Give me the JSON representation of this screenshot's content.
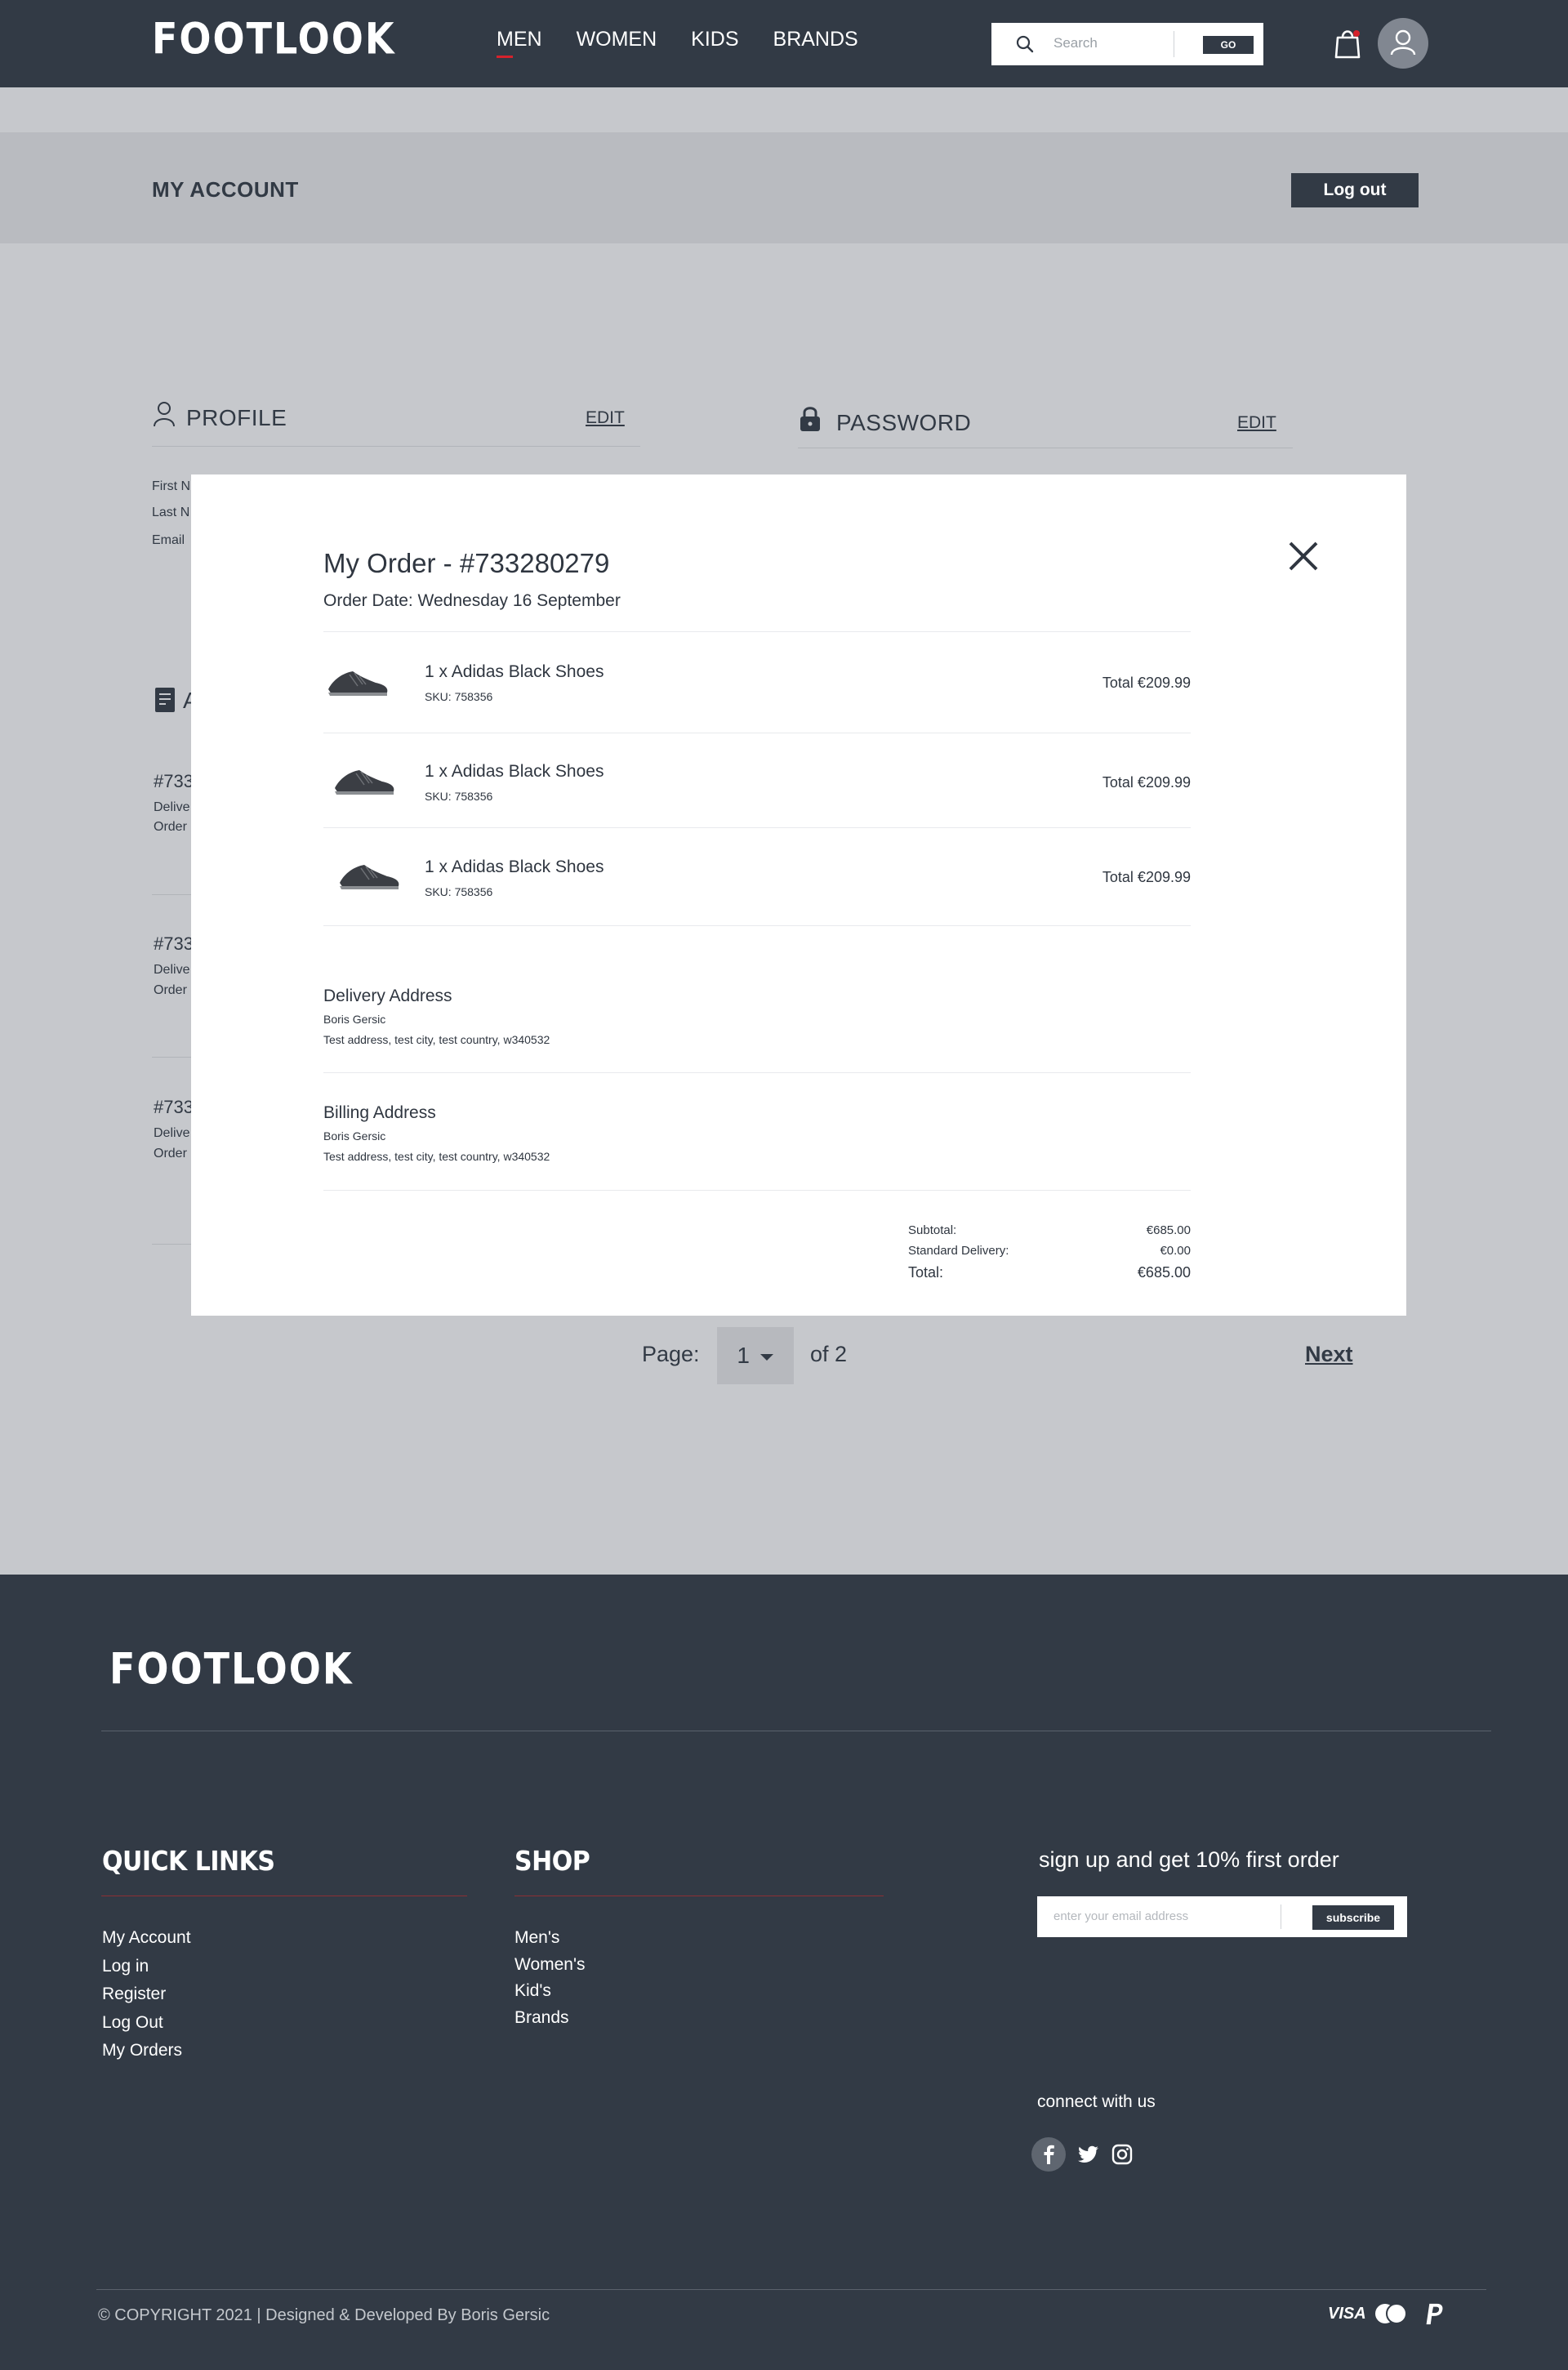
{
  "header": {
    "logo": "FOOTLOOK",
    "nav": [
      "MEN",
      "WOMEN",
      "KIDS",
      "BRANDS"
    ],
    "search_placeholder": "Search",
    "search_button": "GO"
  },
  "account": {
    "title": "MY ACCOUNT",
    "logout": "Log out"
  },
  "background": {
    "profile_heading": "PROFILE",
    "profile_edit": "EDIT",
    "password_heading": "PASSWORD",
    "password_edit": "EDIT",
    "field_first": "First N",
    "field_last": "Last N",
    "field_email": "Email",
    "orders_heading": "A",
    "orders": [
      {
        "number": "#733",
        "delivery": "Delive",
        "order": "Order"
      },
      {
        "number": "#733",
        "delivery": "Delive",
        "order": "Order"
      },
      {
        "number": "#733",
        "delivery": "Delive",
        "order": "Order"
      }
    ]
  },
  "modal": {
    "title": "My Order - #733280279",
    "order_date": "Order Date:  Wednesday 16 September",
    "items": [
      {
        "name": "1 x Adidas Black Shoes",
        "sku": "SKU: 758356",
        "total": "Total €209.99"
      },
      {
        "name": "1 x Adidas Black Shoes",
        "sku": "SKU: 758356",
        "total": "Total €209.99"
      },
      {
        "name": "1 x Adidas Black Shoes",
        "sku": "SKU: 758356",
        "total": "Total €209.99"
      }
    ],
    "delivery": {
      "title": "Delivery Address",
      "name": "Boris Gersic",
      "address": "Test address, test city, test country, w340532"
    },
    "billing": {
      "title": "Billing Address",
      "name": "Boris Gersic",
      "address": "Test address, test city, test country, w340532"
    },
    "summary": {
      "subtotal_label": "Subtotal:",
      "subtotal_value": "€685.00",
      "delivery_label": "Standard Delivery:",
      "delivery_value": "€0.00",
      "total_label": "Total:",
      "total_value": "€685.00"
    }
  },
  "pagination": {
    "label": "Page:",
    "current": "1",
    "of": "of 2",
    "next": "Next"
  },
  "footer": {
    "logo": "FOOTLOOK",
    "quick_links_title": "QUICK LINKS",
    "quick_links": [
      "My Account",
      "Log in",
      "Register",
      "Log Out",
      "My Orders"
    ],
    "shop_title": "SHOP",
    "shop_links": [
      "Men's",
      "Women's",
      "Kid's",
      "Brands"
    ],
    "signup_text": "sign up and get 10% first order",
    "email_placeholder": "enter your email address",
    "subscribe": "subscribe",
    "connect": "connect with us",
    "social": [
      "facebook-icon",
      "twitter-icon",
      "instagram-icon"
    ],
    "copyright": "© COPYRIGHT 2021 | Designed & Developed By Boris Gersic",
    "payments": [
      "VISA",
      "mastercard-icon",
      "paypal-icon"
    ]
  },
  "colors": {
    "primary": "#323a45",
    "accent": "#d6222c",
    "overlay": "#c6c8cc"
  }
}
